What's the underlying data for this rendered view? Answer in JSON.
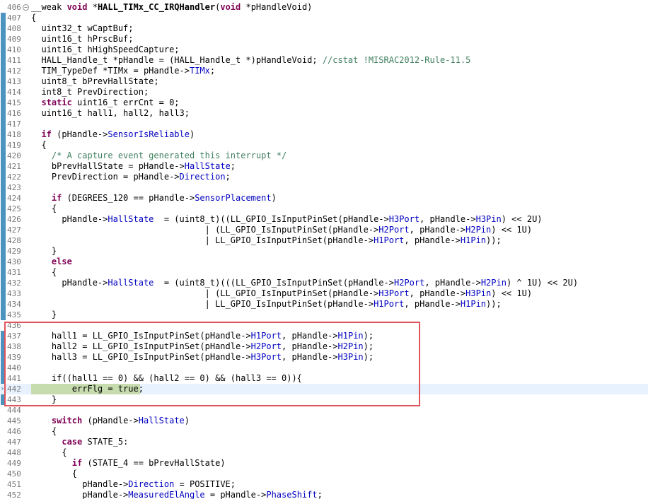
{
  "editor": {
    "current_line": "442",
    "lines": [
      {
        "n": "406",
        "fold": "−",
        "t": [
          {
            "c": "",
            "v": "__weak "
          },
          {
            "c": "kw",
            "v": "void"
          },
          {
            "c": "",
            "v": " *"
          },
          {
            "c": "b",
            "v": "HALL_TIMx_CC_IRQHandler"
          },
          {
            "c": "",
            "v": "("
          },
          {
            "c": "kw",
            "v": "void"
          },
          {
            "c": "",
            "v": " *pHandleVoid)"
          }
        ]
      },
      {
        "n": "407",
        "t": [
          {
            "c": "",
            "v": "{"
          }
        ]
      },
      {
        "n": "408",
        "t": [
          {
            "c": "",
            "v": "  uint32_t wCaptBuf;"
          }
        ]
      },
      {
        "n": "409",
        "t": [
          {
            "c": "",
            "v": "  uint16_t hPrscBuf;"
          }
        ]
      },
      {
        "n": "410",
        "t": [
          {
            "c": "",
            "v": "  uint16_t hHighSpeedCapture;"
          }
        ]
      },
      {
        "n": "411",
        "t": [
          {
            "c": "",
            "v": "  HALL_Handle_t *pHandle = (HALL_Handle_t *)pHandleVoid; "
          },
          {
            "c": "cmt",
            "v": "//cstat !MISRAC2012-Rule-11.5"
          }
        ]
      },
      {
        "n": "412",
        "t": [
          {
            "c": "",
            "v": "  TIM_TypeDef *TIMx = pHandle->"
          },
          {
            "c": "fld",
            "v": "TIMx"
          },
          {
            "c": "",
            "v": ";"
          }
        ]
      },
      {
        "n": "413",
        "t": [
          {
            "c": "",
            "v": "  uint8_t bPrevHallState;"
          }
        ]
      },
      {
        "n": "414",
        "t": [
          {
            "c": "",
            "v": "  int8_t PrevDirection;"
          }
        ]
      },
      {
        "n": "415",
        "t": [
          {
            "c": "",
            "v": "  "
          },
          {
            "c": "kw",
            "v": "static"
          },
          {
            "c": "",
            "v": " uint16_t errCnt = 0;"
          }
        ]
      },
      {
        "n": "416",
        "t": [
          {
            "c": "",
            "v": "  uint16_t hall1, hall2, hall3;"
          }
        ]
      },
      {
        "n": "417",
        "t": [
          {
            "c": "",
            "v": ""
          }
        ]
      },
      {
        "n": "418",
        "t": [
          {
            "c": "",
            "v": "  "
          },
          {
            "c": "kw",
            "v": "if"
          },
          {
            "c": "",
            "v": " (pHandle->"
          },
          {
            "c": "fld",
            "v": "SensorIsReliable"
          },
          {
            "c": "",
            "v": ")"
          }
        ]
      },
      {
        "n": "419",
        "t": [
          {
            "c": "",
            "v": "  {"
          }
        ]
      },
      {
        "n": "420",
        "t": [
          {
            "c": "",
            "v": "    "
          },
          {
            "c": "cmt",
            "v": "/* A capture event generated this interrupt */"
          }
        ]
      },
      {
        "n": "421",
        "t": [
          {
            "c": "",
            "v": "    bPrevHallState = pHandle->"
          },
          {
            "c": "fld",
            "v": "HallState"
          },
          {
            "c": "",
            "v": ";"
          }
        ]
      },
      {
        "n": "422",
        "t": [
          {
            "c": "",
            "v": "    PrevDirection = pHandle->"
          },
          {
            "c": "fld",
            "v": "Direction"
          },
          {
            "c": "",
            "v": ";"
          }
        ]
      },
      {
        "n": "423",
        "t": [
          {
            "c": "",
            "v": ""
          }
        ]
      },
      {
        "n": "424",
        "t": [
          {
            "c": "",
            "v": "    "
          },
          {
            "c": "kw",
            "v": "if"
          },
          {
            "c": "",
            "v": " (DEGREES_120 == pHandle->"
          },
          {
            "c": "fld",
            "v": "SensorPlacement"
          },
          {
            "c": "",
            "v": ")"
          }
        ]
      },
      {
        "n": "425",
        "t": [
          {
            "c": "",
            "v": "    {"
          }
        ]
      },
      {
        "n": "426",
        "t": [
          {
            "c": "",
            "v": "      pHandle->"
          },
          {
            "c": "fld",
            "v": "HallState"
          },
          {
            "c": "",
            "v": "  = (uint8_t)((LL_GPIO_IsInputPinSet(pHandle->"
          },
          {
            "c": "fld",
            "v": "H3Port"
          },
          {
            "c": "",
            "v": ", pHandle->"
          },
          {
            "c": "fld",
            "v": "H3Pin"
          },
          {
            "c": "",
            "v": ") << 2U)"
          }
        ]
      },
      {
        "n": "427",
        "t": [
          {
            "c": "",
            "v": "                                  | (LL_GPIO_IsInputPinSet(pHandle->"
          },
          {
            "c": "fld",
            "v": "H2Port"
          },
          {
            "c": "",
            "v": ", pHandle->"
          },
          {
            "c": "fld",
            "v": "H2Pin"
          },
          {
            "c": "",
            "v": ") << 1U)"
          }
        ]
      },
      {
        "n": "428",
        "t": [
          {
            "c": "",
            "v": "                                  | LL_GPIO_IsInputPinSet(pHandle->"
          },
          {
            "c": "fld",
            "v": "H1Port"
          },
          {
            "c": "",
            "v": ", pHandle->"
          },
          {
            "c": "fld",
            "v": "H1Pin"
          },
          {
            "c": "",
            "v": "));"
          }
        ]
      },
      {
        "n": "429",
        "t": [
          {
            "c": "",
            "v": "    }"
          }
        ]
      },
      {
        "n": "430",
        "t": [
          {
            "c": "",
            "v": "    "
          },
          {
            "c": "kw",
            "v": "else"
          }
        ]
      },
      {
        "n": "431",
        "t": [
          {
            "c": "",
            "v": "    {"
          }
        ]
      },
      {
        "n": "432",
        "t": [
          {
            "c": "",
            "v": "      pHandle->"
          },
          {
            "c": "fld",
            "v": "HallState"
          },
          {
            "c": "",
            "v": "  = (uint8_t)(((LL_GPIO_IsInputPinSet(pHandle->"
          },
          {
            "c": "fld",
            "v": "H2Port"
          },
          {
            "c": "",
            "v": ", pHandle->"
          },
          {
            "c": "fld",
            "v": "H2Pin"
          },
          {
            "c": "",
            "v": ") ^ 1U) << 2U)"
          }
        ]
      },
      {
        "n": "433",
        "t": [
          {
            "c": "",
            "v": "                                  | (LL_GPIO_IsInputPinSet(pHandle->"
          },
          {
            "c": "fld",
            "v": "H3Port"
          },
          {
            "c": "",
            "v": ", pHandle->"
          },
          {
            "c": "fld",
            "v": "H3Pin"
          },
          {
            "c": "",
            "v": ") << 1U)"
          }
        ]
      },
      {
        "n": "434",
        "t": [
          {
            "c": "",
            "v": "                                  | LL_GPIO_IsInputPinSet(pHandle->"
          },
          {
            "c": "fld",
            "v": "H1Port"
          },
          {
            "c": "",
            "v": ", pHandle->"
          },
          {
            "c": "fld",
            "v": "H1Pin"
          },
          {
            "c": "",
            "v": "));"
          }
        ]
      },
      {
        "n": "435",
        "t": [
          {
            "c": "",
            "v": "    }"
          }
        ]
      },
      {
        "n": "436",
        "t": [
          {
            "c": "",
            "v": ""
          }
        ]
      },
      {
        "n": "437",
        "t": [
          {
            "c": "",
            "v": "    hall1 = LL_GPIO_IsInputPinSet(pHandle->"
          },
          {
            "c": "fld",
            "v": "H1Port"
          },
          {
            "c": "",
            "v": ", pHandle->"
          },
          {
            "c": "fld",
            "v": "H1Pin"
          },
          {
            "c": "",
            "v": ");"
          }
        ]
      },
      {
        "n": "438",
        "t": [
          {
            "c": "",
            "v": "    hall2 = LL_GPIO_IsInputPinSet(pHandle->"
          },
          {
            "c": "fld",
            "v": "H2Port"
          },
          {
            "c": "",
            "v": ", pHandle->"
          },
          {
            "c": "fld",
            "v": "H2Pin"
          },
          {
            "c": "",
            "v": ");"
          }
        ]
      },
      {
        "n": "439",
        "t": [
          {
            "c": "",
            "v": "    hall3 = LL_GPIO_IsInputPinSet(pHandle->"
          },
          {
            "c": "fld",
            "v": "H3Port"
          },
          {
            "c": "",
            "v": ", pHandle->"
          },
          {
            "c": "fld",
            "v": "H3Pin"
          },
          {
            "c": "",
            "v": ");"
          }
        ]
      },
      {
        "n": "440",
        "t": [
          {
            "c": "",
            "v": ""
          }
        ]
      },
      {
        "n": "441",
        "t": [
          {
            "c": "",
            "v": "    if((hall1 == 0) && (hall2 == 0) && (hall3 == 0)){"
          }
        ]
      },
      {
        "n": "442",
        "hl": true,
        "t": [
          {
            "c": "",
            "v": "        errFlg = true;"
          }
        ]
      },
      {
        "n": "443",
        "t": [
          {
            "c": "",
            "v": "    }"
          }
        ]
      },
      {
        "n": "444",
        "t": [
          {
            "c": "",
            "v": ""
          }
        ]
      },
      {
        "n": "445",
        "t": [
          {
            "c": "",
            "v": "    "
          },
          {
            "c": "kw",
            "v": "switch"
          },
          {
            "c": "",
            "v": " (pHandle->"
          },
          {
            "c": "fld",
            "v": "HallState"
          },
          {
            "c": "",
            "v": ")"
          }
        ]
      },
      {
        "n": "446",
        "t": [
          {
            "c": "",
            "v": "    {"
          }
        ]
      },
      {
        "n": "447",
        "t": [
          {
            "c": "",
            "v": "      "
          },
          {
            "c": "kw",
            "v": "case"
          },
          {
            "c": "",
            "v": " STATE_5:"
          }
        ]
      },
      {
        "n": "448",
        "t": [
          {
            "c": "",
            "v": "      {"
          }
        ]
      },
      {
        "n": "449",
        "t": [
          {
            "c": "",
            "v": "        "
          },
          {
            "c": "kw",
            "v": "if"
          },
          {
            "c": "",
            "v": " (STATE_4 == bPrevHallState)"
          }
        ]
      },
      {
        "n": "450",
        "t": [
          {
            "c": "",
            "v": "        {"
          }
        ]
      },
      {
        "n": "451",
        "t": [
          {
            "c": "",
            "v": "          pHandle->"
          },
          {
            "c": "fld",
            "v": "Direction"
          },
          {
            "c": "",
            "v": " = POSITIVE;"
          }
        ]
      },
      {
        "n": "452",
        "t": [
          {
            "c": "",
            "v": "          pHandle->"
          },
          {
            "c": "fld",
            "v": "MeasuredElAngle"
          },
          {
            "c": "",
            "v": " = pHandle->"
          },
          {
            "c": "fld",
            "v": "PhaseShift"
          },
          {
            "c": "",
            "v": ";"
          }
        ]
      }
    ]
  },
  "colors": {
    "keyword": "#7f0055",
    "field": "#0000c0",
    "comment": "#3f7f5f",
    "line_number": "#787878",
    "current_line_bg": "#e8f2fe",
    "execution_highlight": "#c6dbae",
    "annotation_box": "#e0545c",
    "change_ruler": "#4a94bf"
  },
  "icons": {
    "fold": "collapse-minus-icon",
    "instruction_pointer": "instruction-pointer-arrow-icon"
  }
}
